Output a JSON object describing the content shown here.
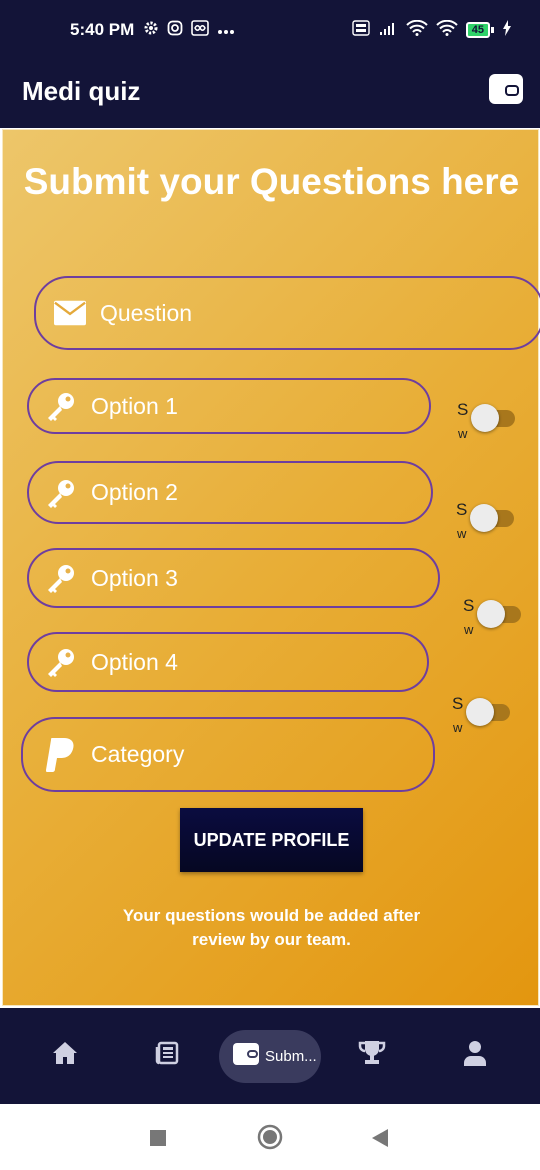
{
  "status_bar": {
    "time": "5:40 PM",
    "battery": "45",
    "left_icons": [
      "gear-icon",
      "instagram-icon",
      "infinity-icon",
      "more-icon"
    ],
    "right_icons": [
      "volte-icon",
      "signal-icon",
      "wifi-icon",
      "wifi-icon",
      "battery-icon",
      "charging-icon"
    ]
  },
  "app_bar": {
    "title": "Medi quiz",
    "action_icon": "wallet-icon"
  },
  "form": {
    "headline": "Submit your Questions here",
    "question_placeholder": "Question",
    "options": [
      {
        "placeholder": "Option 1",
        "toggle_text_top": "S",
        "toggle_text_bottom": "w",
        "toggle_on": false
      },
      {
        "placeholder": "Option 2",
        "toggle_text_top": "S",
        "toggle_text_bottom": "w",
        "toggle_on": false
      },
      {
        "placeholder": "Option 3",
        "toggle_text_top": "S",
        "toggle_text_bottom": "w",
        "toggle_on": false
      },
      {
        "placeholder": "Option 4",
        "toggle_text_top": "S",
        "toggle_text_bottom": "w",
        "toggle_on": false
      }
    ],
    "category_placeholder": "Category",
    "submit_label": "UPDATE PROFILE",
    "note": "Your questions would be added after review by our team."
  },
  "bottom_nav": {
    "items": [
      {
        "icon": "home-icon",
        "label": ""
      },
      {
        "icon": "news-icon",
        "label": ""
      },
      {
        "icon": "wallet-icon",
        "label": "Subm..."
      },
      {
        "icon": "trophy-icon",
        "label": ""
      },
      {
        "icon": "person-icon",
        "label": ""
      }
    ],
    "active_index": 2
  },
  "colors": {
    "bar_bg": "#131438",
    "card_gradient_start": "#edc66a",
    "card_gradient_end": "#e3960f",
    "field_border": "#6e3e9f",
    "button_bg": "#0a0c40",
    "toggle_track": "#a8771c"
  }
}
